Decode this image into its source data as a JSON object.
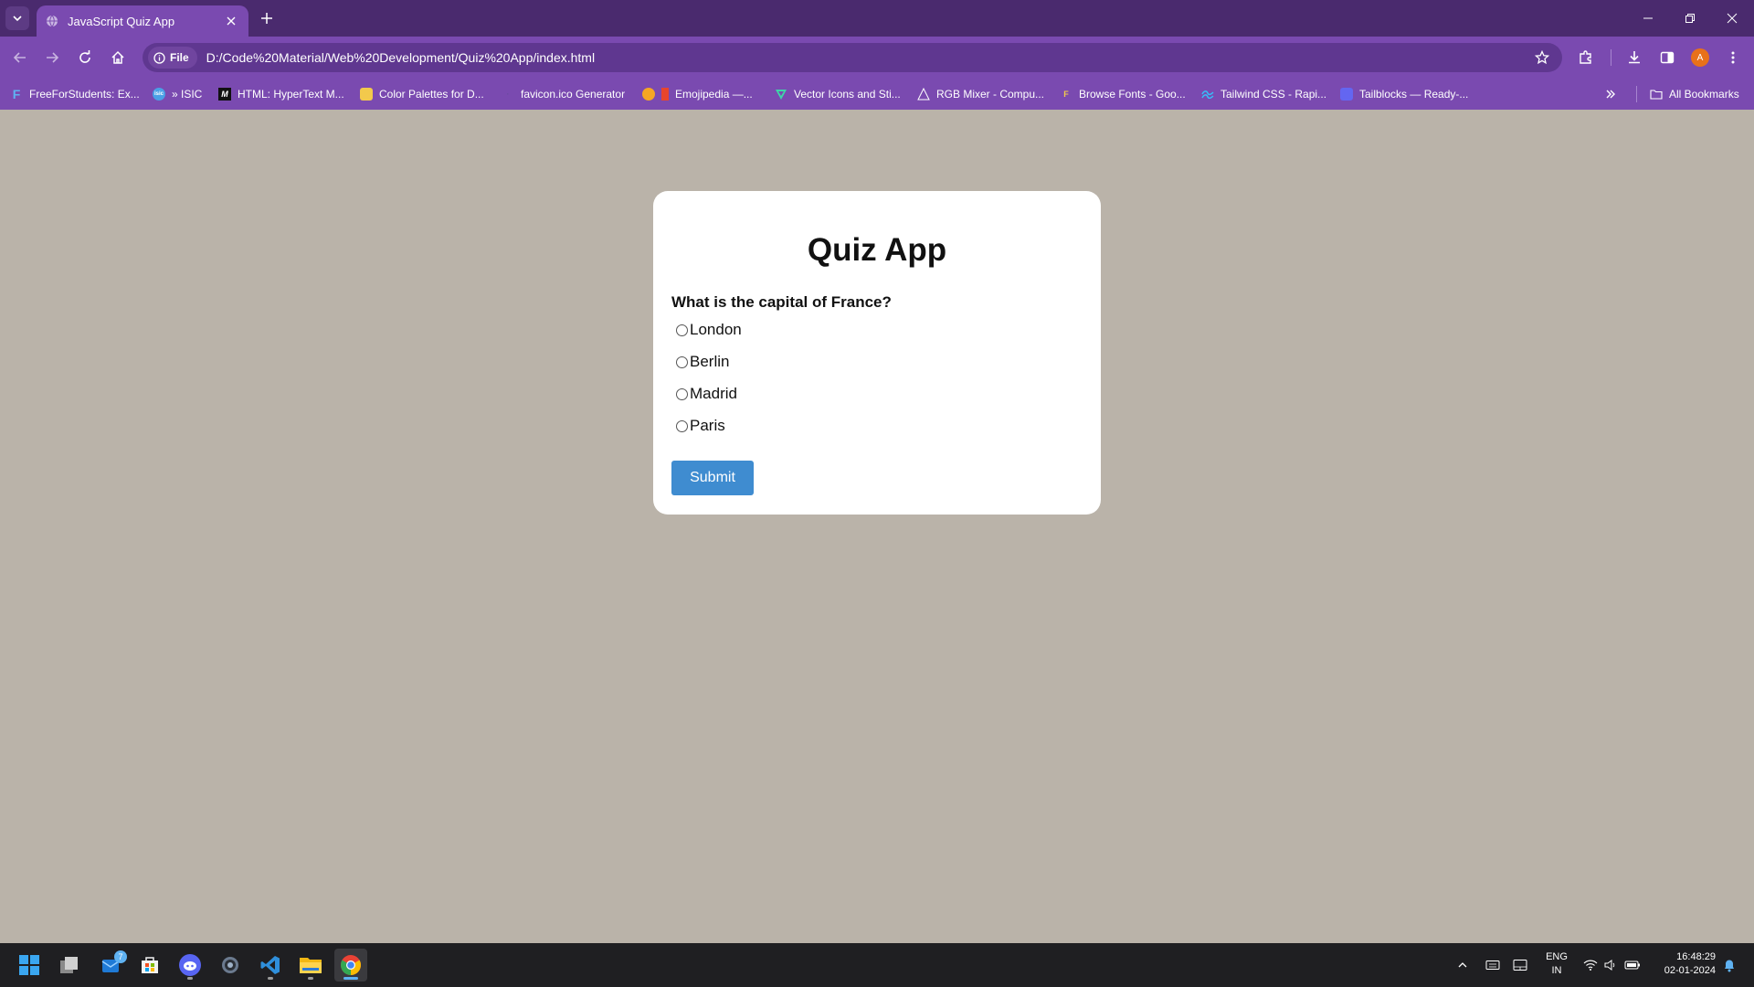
{
  "browser": {
    "tab_title": "JavaScript Quiz App",
    "site_info_label": "File",
    "url": "D:/Code%20Material/Web%20Development/Quiz%20App/index.html",
    "profile_initial": "A",
    "accent_color": "#7a4ab0"
  },
  "bookmarks": {
    "items": [
      {
        "label": "FreeForStudents: Ex...",
        "icon": "freeforstudents-icon"
      },
      {
        "label": "» ISIC",
        "icon": "isic-icon"
      },
      {
        "label": "HTML: HyperText M...",
        "icon": "mdn-icon"
      },
      {
        "label": "Color Palettes for D...",
        "icon": "colorhunt-icon"
      },
      {
        "label": "favicon.ico Generator",
        "icon": "favicon-icon"
      },
      {
        "label": "Emojipedia —...",
        "icon": "emojipedia-icon"
      },
      {
        "label": "Vector Icons and Sti...",
        "icon": "flaticon-icon"
      },
      {
        "label": "RGB Mixer - Compu...",
        "icon": "rgb-mixer-icon"
      },
      {
        "label": "Browse Fonts - Goo...",
        "icon": "google-fonts-icon"
      },
      {
        "label": "Tailwind CSS - Rapi...",
        "icon": "tailwind-icon"
      },
      {
        "label": "Tailblocks — Ready-...",
        "icon": "tailblocks-icon"
      }
    ],
    "all_bookmarks_label": "All Bookmarks"
  },
  "quiz": {
    "title": "Quiz App",
    "question": "What is the capital of France?",
    "answers": [
      "London",
      "Berlin",
      "Madrid",
      "Paris"
    ],
    "submit_label": "Submit",
    "button_color": "#3f8cd0"
  },
  "taskbar": {
    "apps": [
      "start-icon",
      "task-view-icon",
      "mail-icon",
      "store-icon",
      "discord-icon",
      "settings-icon",
      "vscode-icon",
      "file-explorer-icon",
      "chrome-icon"
    ],
    "mail_badge": "7",
    "lang_line1": "ENG",
    "lang_line2": "IN",
    "time": "16:48:29",
    "date": "02-01-2024"
  }
}
